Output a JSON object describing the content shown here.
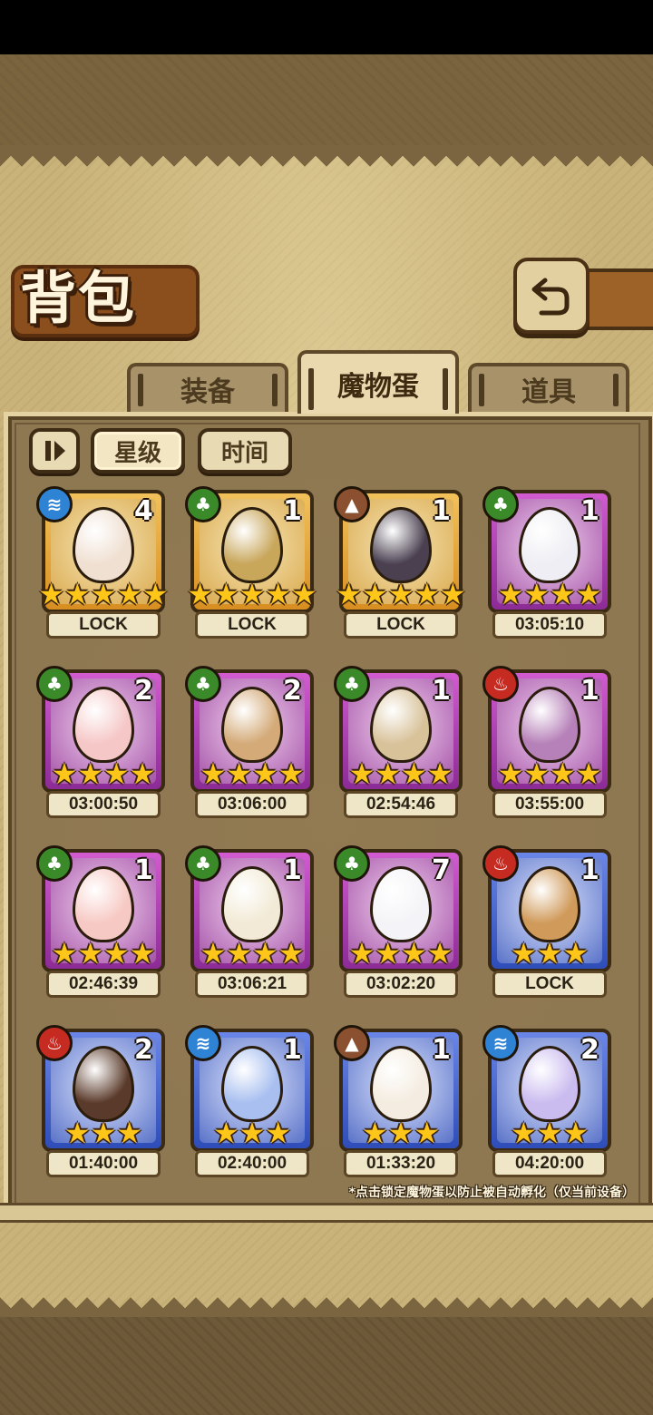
{
  "title": "背包",
  "tabs": [
    {
      "label": "装备",
      "active": false
    },
    {
      "label": "魔物蛋",
      "active": true
    },
    {
      "label": "道具",
      "active": false
    }
  ],
  "sort": {
    "toggle_icon": "pause-icon",
    "options": [
      "星级",
      "时间"
    ],
    "selected": "星级"
  },
  "eggs": [
    {
      "element": "water",
      "rarity": "gold",
      "count": "4",
      "stars": 5,
      "status": "LOCK",
      "egg_color": "#f0e0d2"
    },
    {
      "element": "wood",
      "rarity": "gold",
      "count": "1",
      "stars": 5,
      "status": "LOCK",
      "egg_color": "#c8a65a"
    },
    {
      "element": "earth",
      "rarity": "gold",
      "count": "1",
      "stars": 5,
      "status": "LOCK",
      "egg_color": "#4a4050"
    },
    {
      "element": "wood",
      "rarity": "purple",
      "count": "1",
      "stars": 4,
      "status": "03:05:10",
      "egg_color": "#eeeef4"
    },
    {
      "element": "wood",
      "rarity": "purple",
      "count": "2",
      "stars": 4,
      "status": "03:00:50",
      "egg_color": "#f6c7c7"
    },
    {
      "element": "wood",
      "rarity": "purple",
      "count": "2",
      "stars": 4,
      "status": "03:06:00",
      "egg_color": "#d4aa78"
    },
    {
      "element": "wood",
      "rarity": "purple",
      "count": "1",
      "stars": 4,
      "status": "02:54:46",
      "egg_color": "#d8c29a"
    },
    {
      "element": "fire",
      "rarity": "purple",
      "count": "1",
      "stars": 4,
      "status": "03:55:00",
      "egg_color": "#b680b8"
    },
    {
      "element": "wood",
      "rarity": "purple",
      "count": "1",
      "stars": 4,
      "status": "02:46:39",
      "egg_color": "#f7c9c4"
    },
    {
      "element": "wood",
      "rarity": "purple",
      "count": "1",
      "stars": 4,
      "status": "03:06:21",
      "egg_color": "#f2ead6"
    },
    {
      "element": "wood",
      "rarity": "purple",
      "count": "7",
      "stars": 4,
      "status": "03:02:20",
      "egg_color": "#f4f4f8"
    },
    {
      "element": "fire",
      "rarity": "blue",
      "count": "1",
      "stars": 3,
      "status": "LOCK",
      "egg_color": "#d09a5a"
    },
    {
      "element": "fire",
      "rarity": "blue",
      "count": "2",
      "stars": 3,
      "status": "01:40:00",
      "egg_color": "#5a3a2a"
    },
    {
      "element": "water",
      "rarity": "blue",
      "count": "1",
      "stars": 3,
      "status": "02:40:00",
      "egg_color": "#a8bff0"
    },
    {
      "element": "earth",
      "rarity": "blue",
      "count": "1",
      "stars": 3,
      "status": "01:33:20",
      "egg_color": "#f4ece0"
    },
    {
      "element": "water",
      "rarity": "blue",
      "count": "2",
      "stars": 3,
      "status": "04:20:00",
      "egg_color": "#cbbcf0"
    }
  ],
  "footnote": "*点击锁定魔物蛋以防止被自动孵化（仅当前设备）",
  "colors": {
    "star": "#ffc61a",
    "water": "#2f83d4",
    "wood": "#3a8a2a",
    "earth": "#8a5030",
    "fire": "#c62b22"
  }
}
